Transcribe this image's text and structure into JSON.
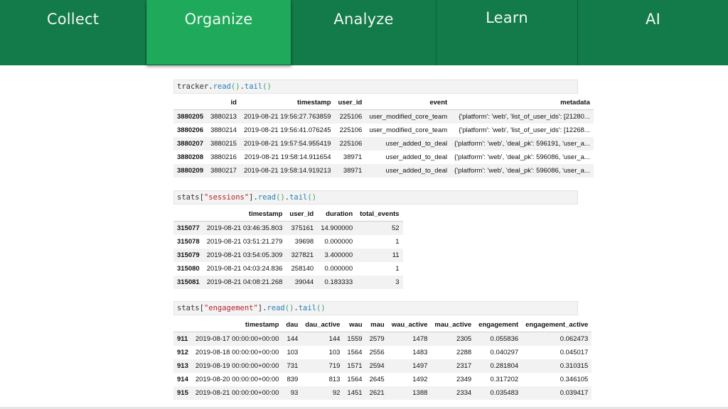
{
  "nav": {
    "tabs": [
      {
        "label": "Collect"
      },
      {
        "label": "Organize"
      },
      {
        "label": "Analyze"
      },
      {
        "label": "Learn"
      },
      {
        "label": "AI"
      }
    ],
    "active": "Organize"
  },
  "cells": {
    "tracker": {
      "code": {
        "var": "tracker",
        "fn1": "read",
        "fn2": "tail"
      },
      "columns": [
        "",
        "id",
        "timestamp",
        "user_id",
        "event",
        "metadata"
      ],
      "rows": [
        [
          "3880205",
          "3880213",
          "2019-08-21 19:56:27.763859",
          "225106",
          "user_modified_core_team",
          "{'platform': 'web', 'list_of_user_ids': [21280..."
        ],
        [
          "3880206",
          "3880214",
          "2019-08-21 19:56:41.076245",
          "225106",
          "user_modified_core_team",
          "{'platform': 'web', 'list_of_user_ids': [12268..."
        ],
        [
          "3880207",
          "3880215",
          "2019-08-21 19:57:54.955419",
          "225106",
          "user_added_to_deal",
          "{'platform': 'web', 'deal_pk': 596191, 'user_a..."
        ],
        [
          "3880208",
          "3880216",
          "2019-08-21 19:58:14.911654",
          "38971",
          "user_added_to_deal",
          "{'platform': 'web', 'deal_pk': 596086, 'user_a..."
        ],
        [
          "3880209",
          "3880217",
          "2019-08-21 19:58:14.919213",
          "38971",
          "user_added_to_deal",
          "{'platform': 'web', 'deal_pk': 596086, 'user_a..."
        ]
      ]
    },
    "sessions": {
      "code": {
        "var": "stats",
        "key": "\"sessions\"",
        "fn1": "read",
        "fn2": "tail"
      },
      "columns": [
        "",
        "timestamp",
        "user_id",
        "duration",
        "total_events"
      ],
      "rows": [
        [
          "315077",
          "2019-08-21 03:46:35.803",
          "375161",
          "14.900000",
          "52"
        ],
        [
          "315078",
          "2019-08-21 03:51:21.279",
          "39698",
          "0.000000",
          "1"
        ],
        [
          "315079",
          "2019-08-21 03:54:05.309",
          "327821",
          "3.400000",
          "11"
        ],
        [
          "315080",
          "2019-08-21 04:03:24.836",
          "258140",
          "0.000000",
          "1"
        ],
        [
          "315081",
          "2019-08-21 04:08:21.268",
          "39044",
          "0.183333",
          "3"
        ]
      ]
    },
    "engagement": {
      "code": {
        "var": "stats",
        "key": "\"engagement\"",
        "fn1": "read",
        "fn2": "tail"
      },
      "columns": [
        "",
        "timestamp",
        "dau",
        "dau_active",
        "wau",
        "mau",
        "wau_active",
        "mau_active",
        "engagement",
        "engagement_active"
      ],
      "rows": [
        [
          "911",
          "2019-08-17 00:00:00+00:00",
          "144",
          "144",
          "1559",
          "2579",
          "1478",
          "2305",
          "0.055836",
          "0.062473"
        ],
        [
          "912",
          "2019-08-18 00:00:00+00:00",
          "103",
          "103",
          "1564",
          "2556",
          "1483",
          "2288",
          "0.040297",
          "0.045017"
        ],
        [
          "913",
          "2019-08-19 00:00:00+00:00",
          "731",
          "719",
          "1571",
          "2594",
          "1497",
          "2317",
          "0.281804",
          "0.310315"
        ],
        [
          "914",
          "2019-08-20 00:00:00+00:00",
          "839",
          "813",
          "1564",
          "2645",
          "1492",
          "2349",
          "0.317202",
          "0.346105"
        ],
        [
          "915",
          "2019-08-21 00:00:00+00:00",
          "93",
          "92",
          "1451",
          "2621",
          "1388",
          "2334",
          "0.035483",
          "0.039417"
        ]
      ]
    }
  },
  "colors": {
    "nav_bg": "#137a49",
    "nav_active": "#1eaa5a"
  }
}
